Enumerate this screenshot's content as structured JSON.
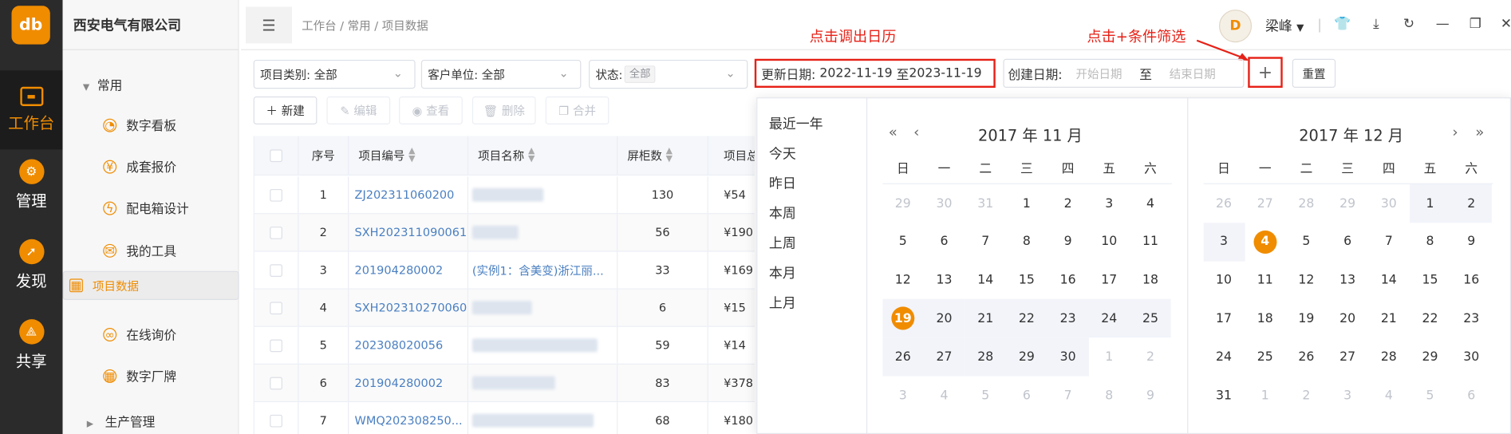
{
  "app": {
    "logo_text": "db",
    "company": "西安电气有限公司"
  },
  "rail": [
    {
      "label": "工作台",
      "icon": "monitor-icon",
      "active": true
    },
    {
      "label": "管理",
      "icon": "gear-icon",
      "active": false
    },
    {
      "label": "发现",
      "icon": "compass-icon",
      "active": false
    },
    {
      "label": "共享",
      "icon": "share-icon",
      "active": false
    }
  ],
  "menu": {
    "group_label": "常用",
    "items": [
      {
        "label": "数字看板",
        "icon": "pie-chart-icon"
      },
      {
        "label": "成套报价",
        "icon": "yuan-icon"
      },
      {
        "label": "配电箱设计",
        "icon": "lightning-icon"
      },
      {
        "label": "我的工具",
        "icon": "mail-icon"
      },
      {
        "label": "项目数据",
        "icon": "grid-icon",
        "selected": true
      },
      {
        "label": "在线询价",
        "icon": "link-icon"
      },
      {
        "label": "数字厂牌",
        "icon": "apps-icon"
      }
    ],
    "group2_label": "生产管理"
  },
  "header": {
    "breadcrumb": "工作台 / 常用 / 项目数据",
    "user_name": "梁峰",
    "avatar_text": "D"
  },
  "filters": {
    "project_type": "项目类别: 全部",
    "customer": "客户单位: 全部",
    "status_label": "状态:",
    "status_tag": "全部",
    "update_label": "更新日期:",
    "update_start": "2022-11-19",
    "update_sep": "至",
    "update_end": "2023-11-19",
    "create_label": "创建日期:",
    "create_start_ph": "开始日期",
    "create_sep": "至",
    "create_end_ph": "结束日期",
    "plus": "+",
    "reset": "重置"
  },
  "annotations": {
    "calendar_note": "点击调出日历",
    "plus_note": "点击+条件筛选"
  },
  "actions": {
    "new": "新建",
    "edit": "编辑",
    "view": "查看",
    "delete": "删除",
    "merge": "合并"
  },
  "table": {
    "headers": {
      "index": "序号",
      "code": "项目编号",
      "name": "项目名称",
      "cabinets": "屏柜数",
      "total": "项目总"
    },
    "rows": [
      {
        "index": "1",
        "code": "ZJ202311060200",
        "name": "",
        "cabinets": "130",
        "total": "¥54"
      },
      {
        "index": "2",
        "code": "SXH202311090061",
        "name": "",
        "cabinets": "56",
        "total": "¥190"
      },
      {
        "index": "3",
        "code": "201904280002",
        "name": "(实例1：含美变)浙江丽...",
        "cabinets": "33",
        "total": "¥169"
      },
      {
        "index": "4",
        "code": "SXH202310270060",
        "name": "",
        "cabinets": "6",
        "total": "¥15"
      },
      {
        "index": "5",
        "code": "202308020056",
        "name": "",
        "cabinets": "59",
        "total": "¥14"
      },
      {
        "index": "6",
        "code": "201904280002",
        "name": "",
        "cabinets": "83",
        "total": "¥378"
      },
      {
        "index": "7",
        "code": "WMQ202308250...",
        "name": "",
        "cabinets": "68",
        "total": "¥180"
      }
    ]
  },
  "calendar": {
    "shortcuts": [
      "最近一年",
      "今天",
      "昨日",
      "本周",
      "上周",
      "本月",
      "上月"
    ],
    "weekdays": [
      "日",
      "一",
      "二",
      "三",
      "四",
      "五",
      "六"
    ],
    "left_title": "2017 年 11 月",
    "right_title": "2017 年 12 月",
    "left_days": [
      "29",
      "30",
      "31",
      "1",
      "2",
      "3",
      "4",
      "5",
      "6",
      "7",
      "8",
      "9",
      "10",
      "11",
      "12",
      "13",
      "14",
      "15",
      "16",
      "17",
      "18",
      "19",
      "20",
      "21",
      "22",
      "23",
      "24",
      "25",
      "26",
      "27",
      "28",
      "29",
      "30",
      "1",
      "2",
      "3",
      "4",
      "5",
      "6",
      "7",
      "8",
      "9"
    ],
    "right_days": [
      "26",
      "27",
      "28",
      "29",
      "30",
      "1",
      "2",
      "3",
      "4",
      "5",
      "6",
      "7",
      "8",
      "9",
      "10",
      "11",
      "12",
      "13",
      "14",
      "15",
      "16",
      "17",
      "18",
      "19",
      "20",
      "21",
      "22",
      "23",
      "24",
      "25",
      "26",
      "27",
      "28",
      "29",
      "30",
      "31",
      "1",
      "2",
      "3",
      "4",
      "5",
      "6"
    ]
  }
}
